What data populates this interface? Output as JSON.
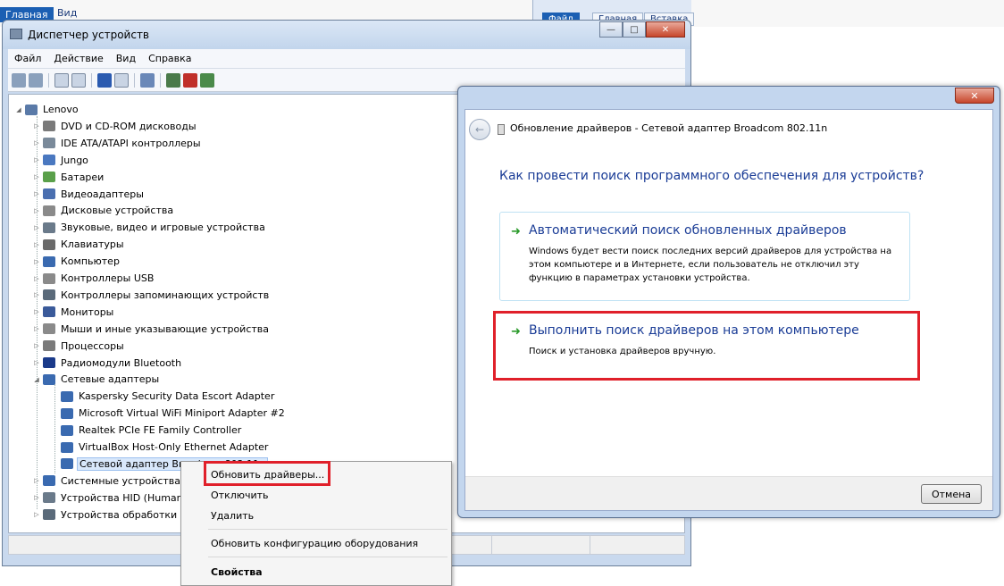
{
  "background_window": {
    "tabs": [
      "Главная",
      "Вид"
    ],
    "ribbon_tabs": [
      "Файл",
      "Главная",
      "Вставка"
    ]
  },
  "device_manager": {
    "title": "Диспетчер устройств",
    "menu": [
      "Файл",
      "Действие",
      "Вид",
      "Справка"
    ],
    "root": "Lenovo",
    "categories": [
      {
        "label": "DVD и CD-ROM дисководы",
        "color": "#7a7a7a"
      },
      {
        "label": "IDE ATA/ATAPI контроллеры",
        "color": "#7a8a9a"
      },
      {
        "label": "Jungo",
        "color": "#4a78c0"
      },
      {
        "label": "Батареи",
        "color": "#5aa04a"
      },
      {
        "label": "Видеоадаптеры",
        "color": "#4a6fb0"
      },
      {
        "label": "Дисковые устройства",
        "color": "#8a8a8a"
      },
      {
        "label": "Звуковые, видео и игровые устройства",
        "color": "#6a7a8a"
      },
      {
        "label": "Клавиатуры",
        "color": "#6a6a6a"
      },
      {
        "label": "Компьютер",
        "color": "#3a6ab0"
      },
      {
        "label": "Контроллеры USB",
        "color": "#8a8a8a"
      },
      {
        "label": "Контроллеры запоминающих устройств",
        "color": "#5a6a7a"
      },
      {
        "label": "Мониторы",
        "color": "#3a5a9a"
      },
      {
        "label": "Мыши и иные указывающие устройства",
        "color": "#8a8a8a"
      },
      {
        "label": "Процессоры",
        "color": "#7a7a7a"
      },
      {
        "label": "Радиомодули Bluetooth",
        "color": "#1a3a8a"
      },
      {
        "label": "Сетевые адаптеры",
        "color": "#3a6ab0"
      }
    ],
    "network_adapters": [
      "Kaspersky Security Data Escort Adapter",
      "Microsoft Virtual WiFi Miniport Adapter #2",
      "Realtek PCIe FE Family Controller",
      "VirtualBox Host-Only Ethernet Adapter",
      "Сетевой адаптер Broadcom 802.11n"
    ],
    "categories_after": [
      {
        "label": "Системные устройства",
        "color": "#3a6ab0"
      },
      {
        "label": "Устройства HID (Human",
        "color": "#6a7a8a"
      },
      {
        "label": "Устройства обработки из",
        "color": "#5a6a7a"
      }
    ]
  },
  "context_menu": {
    "update_drivers": "Обновить драйверы...",
    "disable": "Отключить",
    "delete": "Удалить",
    "scan_hardware": "Обновить конфигурацию оборудования",
    "properties": "Свойства"
  },
  "update_dialog": {
    "heading": "Обновление драйверов - Сетевой адаптер Broadcom 802.11n",
    "question": "Как провести поиск программного обеспечения для устройств?",
    "option_auto": {
      "title": "Автоматический поиск обновленных драйверов",
      "desc": "Windows будет вести поиск последних версий драйверов для устройства на этом компьютере и в Интернете, если пользователь не отключил эту функцию в параметрах установки устройства."
    },
    "option_manual": {
      "title": "Выполнить поиск драйверов на этом компьютере",
      "desc": "Поиск и установка драйверов вручную."
    },
    "cancel": "Отмена"
  },
  "colors": {
    "highlight_red": "#e0202a",
    "link_blue": "#1a3c96",
    "arrow_green": "#2a9a2a"
  }
}
